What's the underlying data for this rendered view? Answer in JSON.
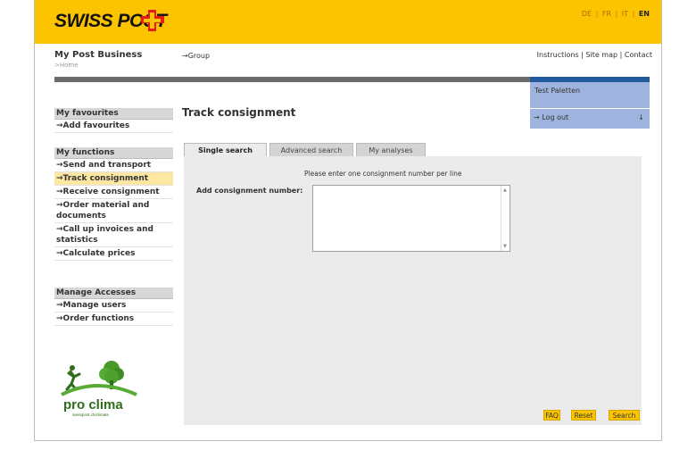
{
  "header": {
    "logo_text": "SWISS POST",
    "languages": [
      "DE",
      "FR",
      "IT",
      "EN"
    ],
    "active_language": "EN",
    "brand_color": "#fcc400"
  },
  "portal": {
    "title": "My Post Business",
    "breadcrumb": ">Home",
    "group_link": "→Group"
  },
  "toplinks": [
    "Instructions",
    "Site map",
    "Contact"
  ],
  "user": {
    "name": "Test Paletten",
    "logout_label": "→ Log out",
    "logout_icon": "↓"
  },
  "sidebar": {
    "favourites": {
      "heading": "My favourites",
      "items": [
        "→Add favourites"
      ]
    },
    "functions": {
      "heading": "My functions",
      "items": [
        "→Send and transport",
        "→Track consignment",
        "→Receive consignment",
        "→Order material and documents",
        "→Call up invoices and statistics",
        "→Calculate prices"
      ],
      "selected_index": 1
    },
    "accesses": {
      "heading": "Manage Accesses",
      "items": [
        "→Manage users",
        "→Order functions"
      ]
    }
  },
  "climate_logo": {
    "brand": "pro clima",
    "url_text": "swisspost.ch/climate"
  },
  "main": {
    "title": "Track consignment",
    "tabs": [
      "Single search",
      "Advanced search",
      "My analyses"
    ],
    "active_tab": 0,
    "instruction": "Please enter one consignment number per line",
    "field_label": "Add consignment number:",
    "field_value": "",
    "buttons": [
      "FAQ",
      "Reset",
      "Search"
    ]
  }
}
